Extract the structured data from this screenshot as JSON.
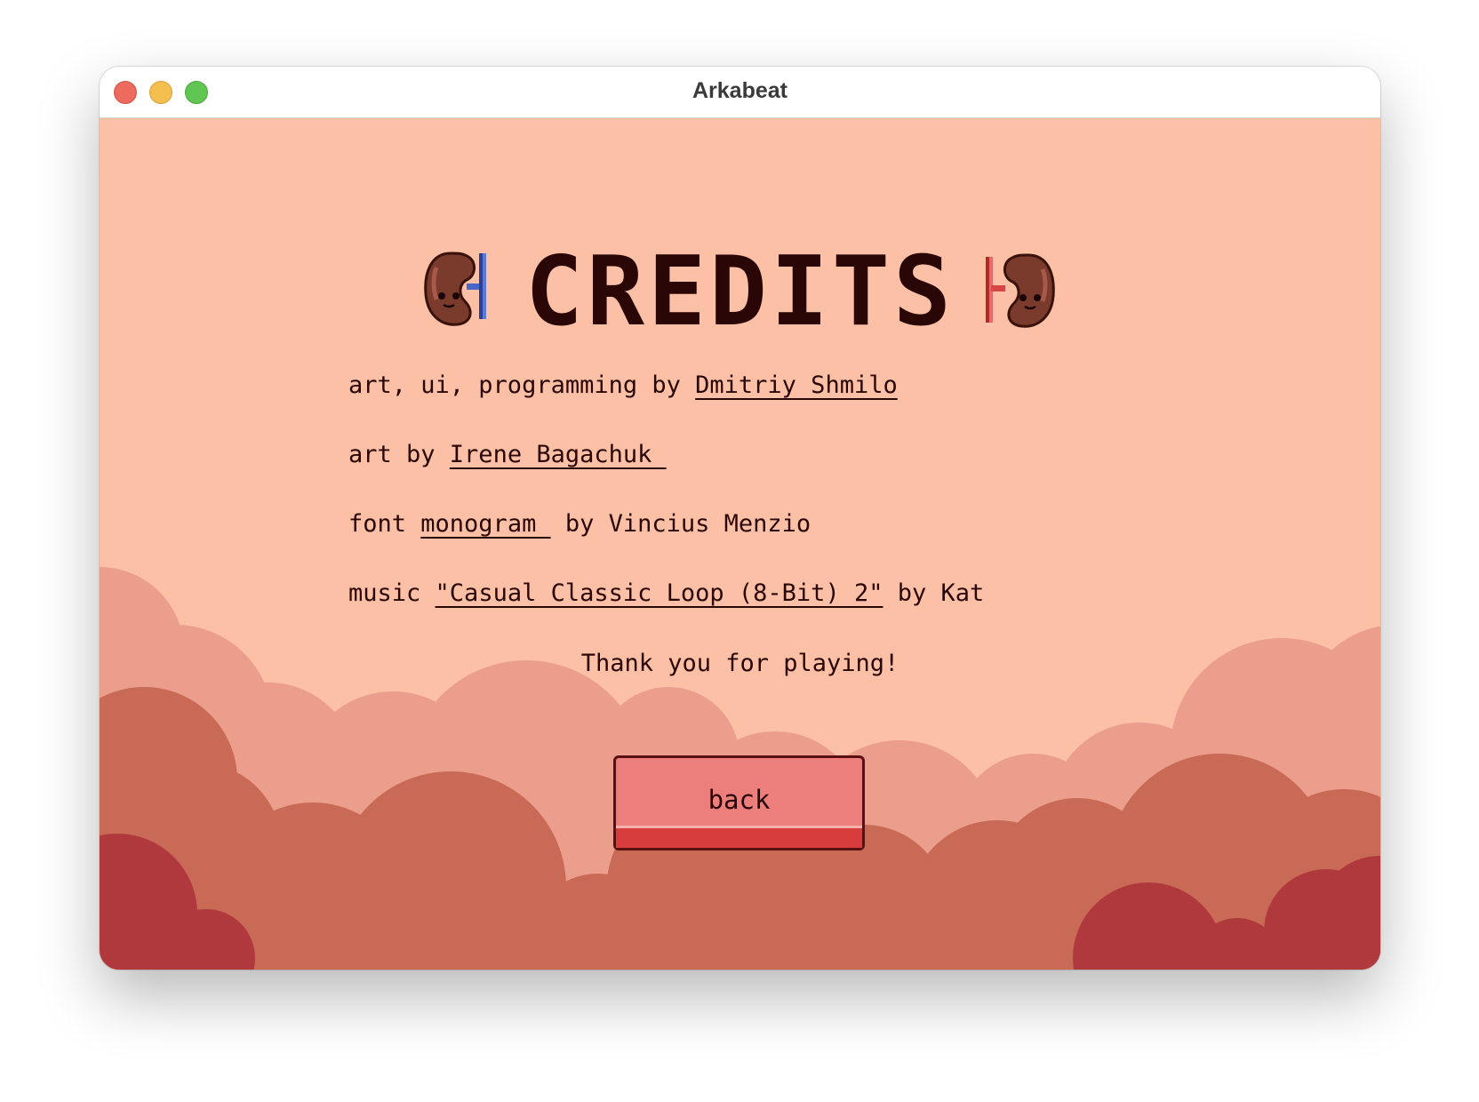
{
  "window": {
    "title": "Arkabeat"
  },
  "screen": {
    "heading": "CREDITS",
    "credits": [
      {
        "prefix": "art, ui, programming by ",
        "link": "Dmitriy Shmilo",
        "suffix": ""
      },
      {
        "prefix": "art by ",
        "link": "Irene Bagachuk ",
        "suffix": ""
      },
      {
        "prefix": "font ",
        "link": "monogram ",
        "suffix": " by Vincius Menzio"
      },
      {
        "prefix": "music ",
        "link": "\"Casual Classic Loop (8-Bit) 2\"",
        "suffix": " by Kat"
      }
    ],
    "thanks": "Thank you for playing!",
    "back_label": "back"
  },
  "colors": {
    "background": "#fbc0a5",
    "cloud_light": "#ec9e8d",
    "cloud_mid": "#c86a55",
    "cloud_dark": "#b0393d",
    "text": "#2a0606",
    "button": "#ec7f7c",
    "button_base": "#d83d3d"
  },
  "icons": {
    "left_decoration": "kidney-blue-icon",
    "right_decoration": "kidney-red-icon"
  }
}
